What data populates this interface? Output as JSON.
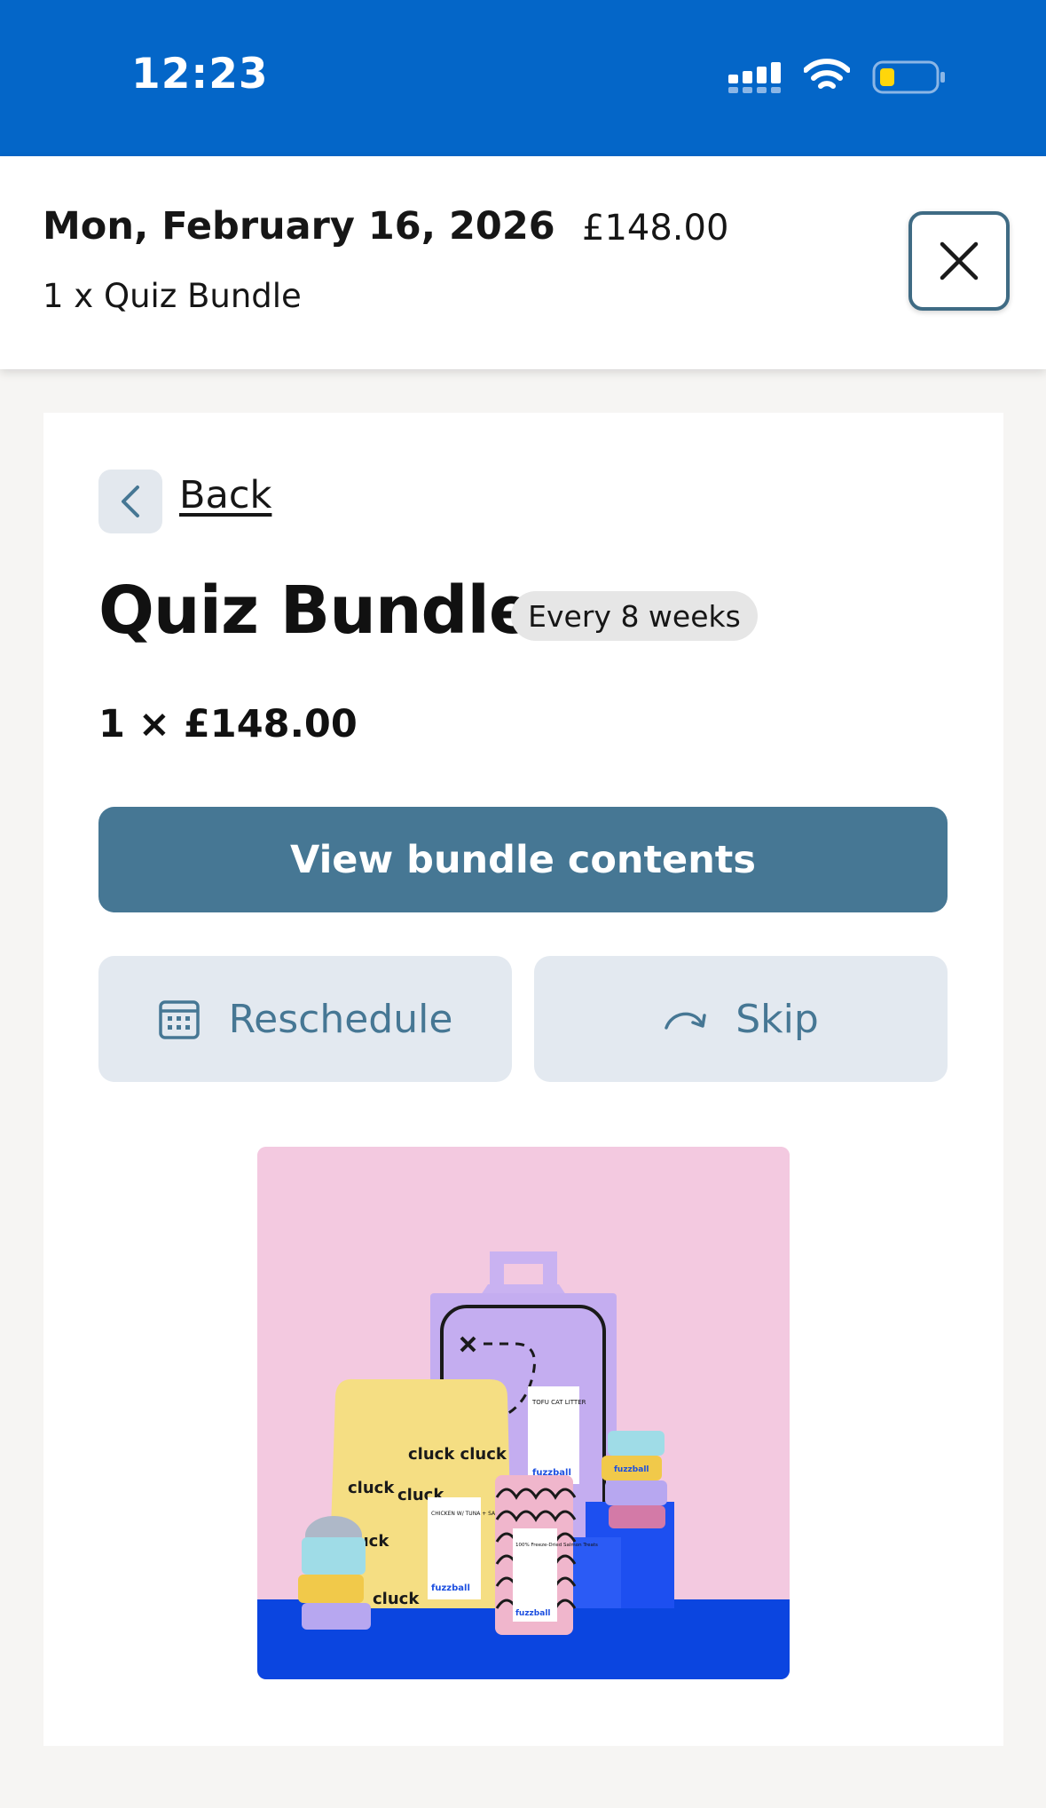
{
  "status_bar": {
    "time": "12:23"
  },
  "header": {
    "date": "Mon, February 16, 2026",
    "price": "£148.00",
    "item": "1 x Quiz Bundle"
  },
  "card": {
    "back_label": "Back",
    "title": "Quiz Bundle",
    "frequency": "Every 8 weeks",
    "qty_price": "1 × £148.00",
    "view_button": "View bundle contents",
    "reschedule_button": "Reschedule",
    "skip_button": "Skip"
  },
  "product_image": {
    "bag_lines": [
      "cluck cluck",
      "cluck",
      "cluck",
      "cluck",
      "cluck"
    ],
    "bag_label": "CHICKEN W/ TUNA + SALMON",
    "bag_brand": "fuzzball",
    "litter_label": "TOFU CAT LITTER",
    "litter_brand": "fuzzball",
    "treats_label": "100% Freeze-Dried Salmon Treats",
    "treats_brand": "fuzzball",
    "tin_brand": "fuzzball"
  },
  "colors": {
    "status_bar": "#0466c8",
    "primary_button": "#467794",
    "secondary_button": "#e3e9f0",
    "image_background": "#f3c9e0"
  },
  "icons": {
    "signal": "signal-icon",
    "wifi": "wifi-icon",
    "battery": "battery-icon",
    "close": "close-icon",
    "back": "chevron-left-icon",
    "calendar": "calendar-icon",
    "skip": "skip-arrow-icon"
  }
}
